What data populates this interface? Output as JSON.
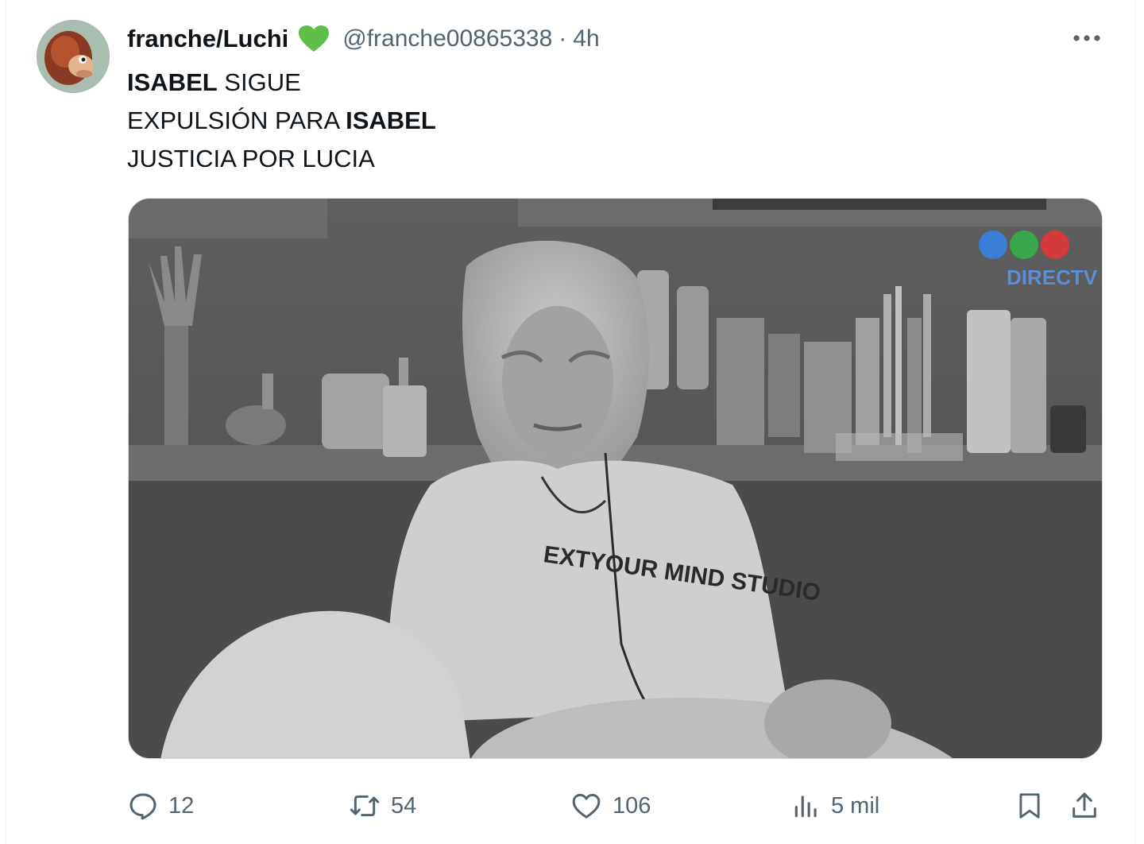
{
  "tweet": {
    "author_name": "franche/Luchi",
    "handle": "@franche00865338",
    "separator": "·",
    "time": "4h",
    "lines": [
      {
        "bold": "ISABEL",
        "rest": " SIGUE"
      },
      {
        "pre": "EXPULSIÓN PARA ",
        "bold": "ISABEL"
      },
      {
        "plain": "JUSTICIA POR LUCIA"
      }
    ],
    "media_watermark": "DIRECTV",
    "media_caption": "EXTYOUR MIND STUDIO"
  },
  "actions": {
    "replies": "12",
    "reposts": "54",
    "likes": "106",
    "views": "5 mil"
  },
  "icons": {
    "heart_emoji": "green-heart-icon",
    "more": "more-horizontal-icon",
    "reply": "reply-icon",
    "repost": "repost-icon",
    "like": "like-icon",
    "views": "views-icon",
    "bookmark": "bookmark-icon",
    "share": "share-icon"
  },
  "colors": {
    "text": "#0f1419",
    "secondary": "#536471",
    "heart": "#5fbf4a"
  }
}
